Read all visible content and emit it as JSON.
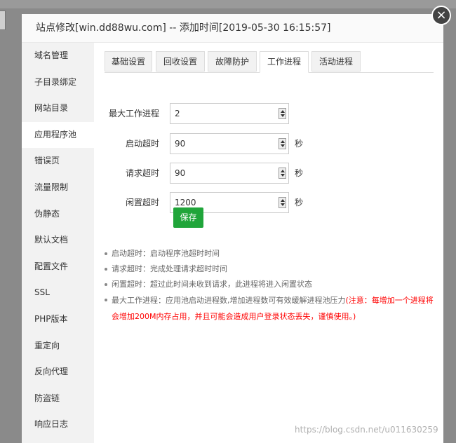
{
  "dialog": {
    "title": "站点修改[win.dd88wu.com] -- 添加时间[2019-05-30 16:15:57]",
    "close_label": "×"
  },
  "sidebar": {
    "items": [
      {
        "label": "域名管理"
      },
      {
        "label": "子目录绑定"
      },
      {
        "label": "网站目录"
      },
      {
        "label": "应用程序池",
        "active": true
      },
      {
        "label": "错误页"
      },
      {
        "label": "流量限制"
      },
      {
        "label": "伪静态"
      },
      {
        "label": "默认文档"
      },
      {
        "label": "配置文件"
      },
      {
        "label": "SSL"
      },
      {
        "label": "PHP版本"
      },
      {
        "label": "重定向"
      },
      {
        "label": "反向代理"
      },
      {
        "label": "防盗链"
      },
      {
        "label": "响应日志"
      }
    ]
  },
  "tabs": [
    {
      "label": "基础设置"
    },
    {
      "label": "回收设置"
    },
    {
      "label": "故障防护"
    },
    {
      "label": "工作进程",
      "active": true
    },
    {
      "label": "活动进程"
    }
  ],
  "form": {
    "max_workers": {
      "label": "最大工作进程",
      "value": "2"
    },
    "startup_timeout": {
      "label": "启动超时",
      "value": "90",
      "unit": "秒"
    },
    "request_timeout": {
      "label": "请求超时",
      "value": "90",
      "unit": "秒"
    },
    "idle_timeout": {
      "label": "闲置超时",
      "value": "1200",
      "unit": "秒"
    },
    "save_label": "保存"
  },
  "notes": {
    "startup": "启动超时：启动程序池超时时间",
    "request": "请求超时：完成处理请求超时时间",
    "idle": "闲置超时：超过此时间未收到请求，此进程将进入闲置状态",
    "workers_prefix": "最大工作进程：应用池启动进程数,增加进程数可有效缓解进程池压力",
    "workers_warning": "(注意：每增加一个进程将会增加200M内存占用，并且可能会造成用户登录状态丢失，谨慎使用。)"
  },
  "watermark": "https://blog.csdn.net/u011630259",
  "colors": {
    "accent": "#20a53a",
    "warning": "#ff0000",
    "sidebar_bg": "#f2f2f2",
    "overlay": "#8a8a8a"
  }
}
